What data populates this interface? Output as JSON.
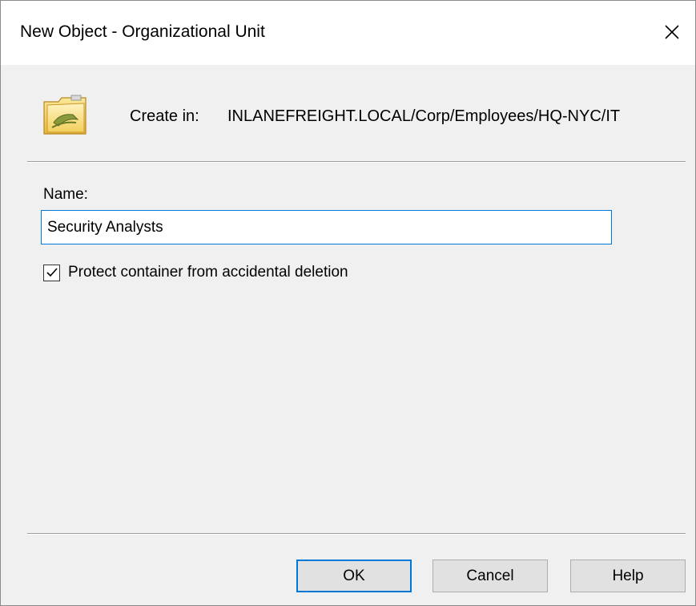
{
  "window": {
    "title": "New Object - Organizational Unit",
    "close_glyph": "✕"
  },
  "header": {
    "icon": "organizational-unit-folder-icon",
    "create_in_label": "Create in:",
    "create_in_path": "INLANEFREIGHT.LOCAL/Corp/Employees/HQ-NYC/IT"
  },
  "form": {
    "name_label": "Name:",
    "name_value": "Security Analysts",
    "protect_label": "Protect container from accidental deletion",
    "protect_checked": true
  },
  "buttons": {
    "ok_label": "OK",
    "cancel_label": "Cancel",
    "help_label": "Help"
  },
  "colors": {
    "accent": "#0078d7",
    "dialog_bg": "#f0f0f0",
    "button_bg": "#e1e1e1",
    "folder_yellow": "#f4d56a"
  }
}
